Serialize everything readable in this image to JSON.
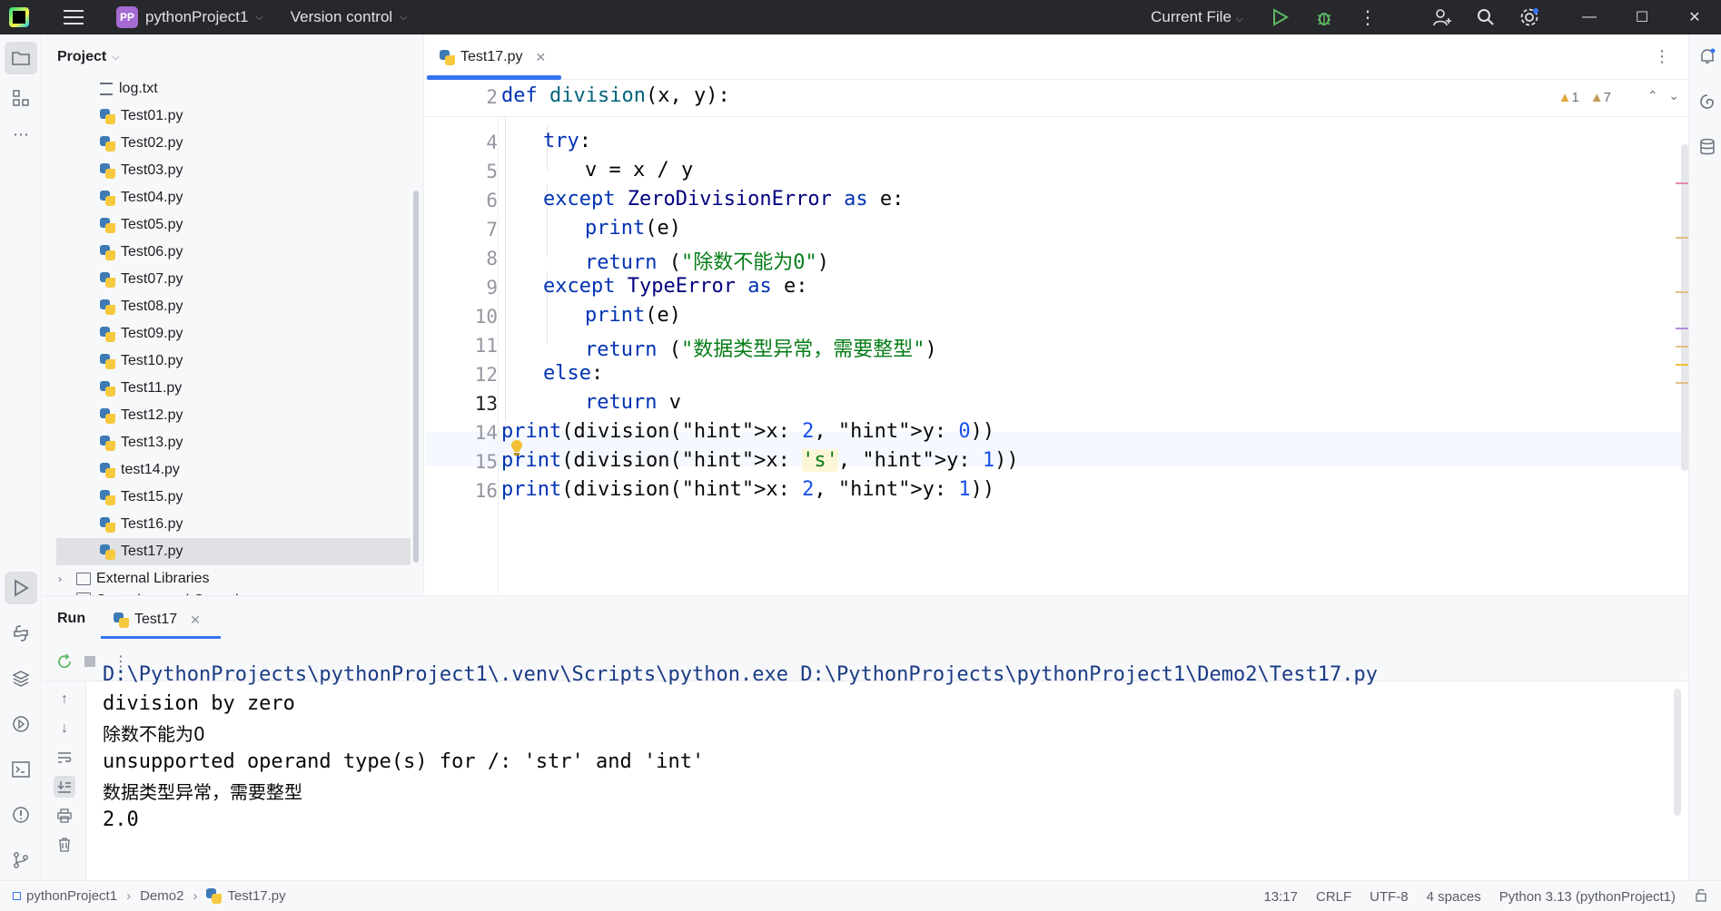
{
  "titlebar": {
    "project_badge": "PP",
    "project_name": "pythonProject1",
    "version_control": "Version control",
    "current_file": "Current File"
  },
  "project_panel": {
    "title": "Project",
    "files": [
      {
        "name": "log.txt",
        "type": "txt"
      },
      {
        "name": "Test01.py",
        "type": "py"
      },
      {
        "name": "Test02.py",
        "type": "py"
      },
      {
        "name": "Test03.py",
        "type": "py"
      },
      {
        "name": "Test04.py",
        "type": "py"
      },
      {
        "name": "Test05.py",
        "type": "py"
      },
      {
        "name": "Test06.py",
        "type": "py"
      },
      {
        "name": "Test07.py",
        "type": "py"
      },
      {
        "name": "Test08.py",
        "type": "py"
      },
      {
        "name": "Test09.py",
        "type": "py"
      },
      {
        "name": "Test10.py",
        "type": "py"
      },
      {
        "name": "Test11.py",
        "type": "py"
      },
      {
        "name": "Test12.py",
        "type": "py"
      },
      {
        "name": "Test13.py",
        "type": "py"
      },
      {
        "name": "test14.py",
        "type": "py"
      },
      {
        "name": "Test15.py",
        "type": "py"
      },
      {
        "name": "Test16.py",
        "type": "py"
      },
      {
        "name": "Test17.py",
        "type": "py",
        "selected": true
      }
    ],
    "external_libraries": "External Libraries",
    "scratches": "Scratches and Consoles"
  },
  "editor": {
    "tab_label": "Test17.py",
    "warnings_count": "1",
    "weak_warnings_count": "7",
    "lines": [
      {
        "num": "2",
        "text": "def division(x, y):"
      },
      {
        "num": "4",
        "text": "try:"
      },
      {
        "num": "5",
        "text": "v = x / y"
      },
      {
        "num": "6",
        "text": "except ZeroDivisionError as e:"
      },
      {
        "num": "7",
        "text": "print(e)"
      },
      {
        "num": "8",
        "text": "return (\"除数不能为0\")"
      },
      {
        "num": "9",
        "text": "except TypeError as e:"
      },
      {
        "num": "10",
        "text": "print(e)"
      },
      {
        "num": "11",
        "text": "return (\"数据类型异常，需要整型\")"
      },
      {
        "num": "12",
        "text": "else:"
      },
      {
        "num": "13",
        "text": "return v"
      },
      {
        "num": "14",
        "text": "print(division(x: 2, y: 0))"
      },
      {
        "num": "15",
        "text": "print(division(x: 's', y: 1))"
      },
      {
        "num": "16",
        "text": "print(division(x: 2, y: 1))"
      }
    ]
  },
  "run_panel": {
    "title": "Run",
    "tab_label": "Test17",
    "output": [
      "D:\\PythonProjects\\pythonProject1\\.venv\\Scripts\\python.exe D:\\PythonProjects\\pythonProject1\\Demo2\\Test17.py",
      "division by zero",
      "除数不能为0",
      "unsupported operand type(s) for /: 'str' and 'int'",
      "数据类型异常，需要整型",
      "2.0"
    ]
  },
  "statusbar": {
    "breadcrumb": [
      "pythonProject1",
      "Demo2",
      "Test17.py"
    ],
    "position": "13:17",
    "line_sep": "CRLF",
    "encoding": "UTF-8",
    "indent": "4 spaces",
    "interpreter": "Python 3.13 (pythonProject1)"
  }
}
